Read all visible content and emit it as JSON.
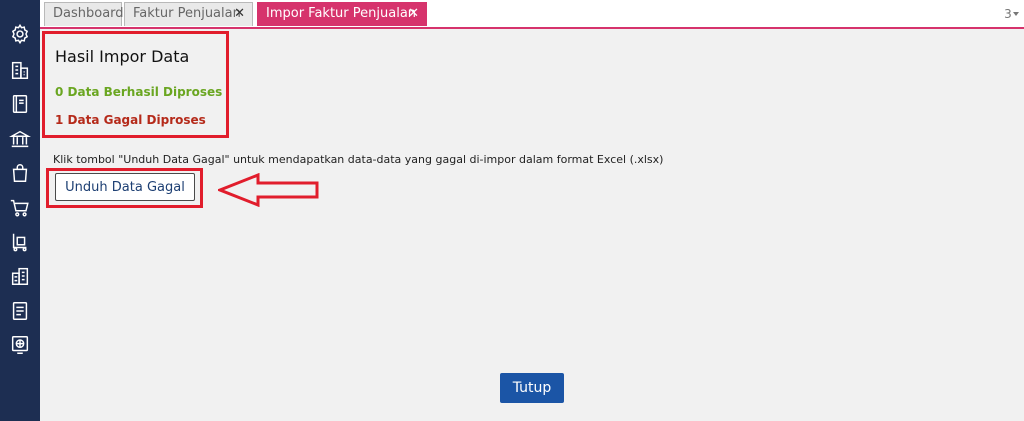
{
  "tabs": [
    {
      "label": "Dashboard",
      "closable": false,
      "active": false
    },
    {
      "label": "Faktur Penjualan",
      "closable": true,
      "active": false
    },
    {
      "label": "Impor Faktur Penjualan",
      "closable": true,
      "active": true
    }
  ],
  "tab_close_symbol": "✕",
  "tab_count": "3",
  "sidebar": {
    "icons": [
      "gear-icon",
      "building-icon",
      "book-icon",
      "bank-icon",
      "shopping-bag-icon",
      "cart-icon",
      "trolley-icon",
      "city-icon",
      "tax-document-icon",
      "globe-monitor-icon"
    ]
  },
  "result": {
    "title": "Hasil Impor Data",
    "success_text": "0 Data Berhasil Diproses",
    "failed_text": "1 Data Gagal Diproses"
  },
  "hint": "Klik tombol \"Unduh Data Gagal\" untuk mendapatkan data-data yang gagal di-impor dalam format Excel (.xlsx)",
  "buttons": {
    "download_failed": "Unduh Data Gagal",
    "close": "Tutup"
  },
  "colors": {
    "sidebar": "#1d2e52",
    "active_tab": "#d6336c",
    "highlight": "#e11d2c",
    "success": "#6aa621",
    "failed": "#b52a1a",
    "primary_button": "#1b55a6"
  }
}
